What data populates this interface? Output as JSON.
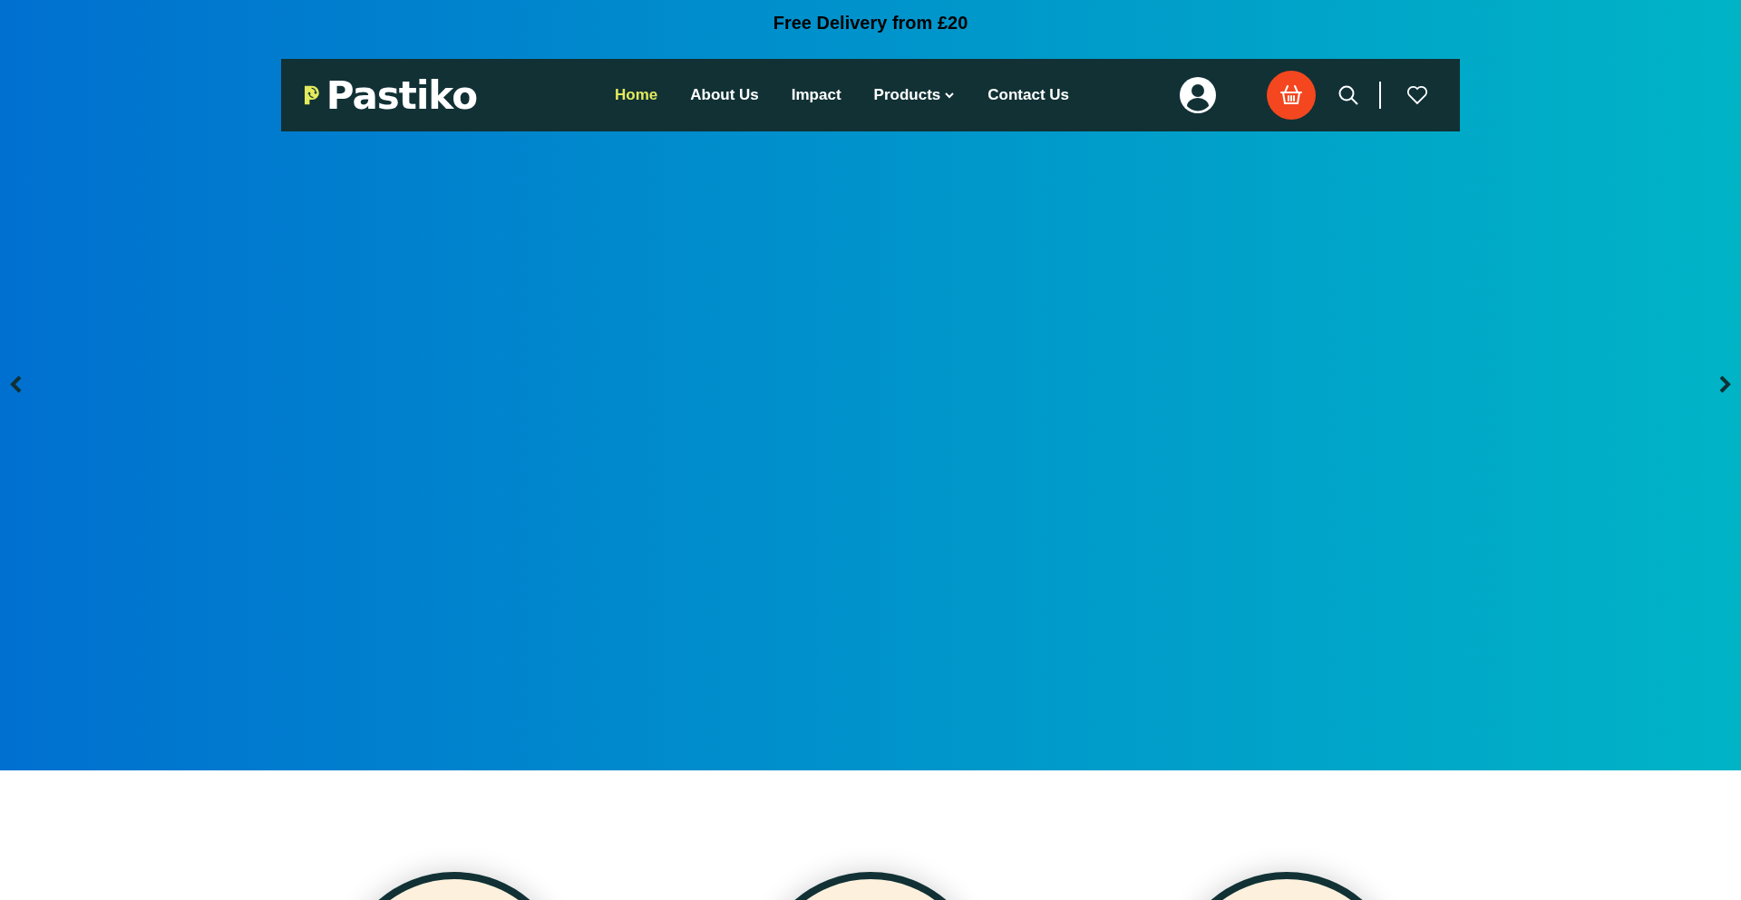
{
  "announcement": "Free Delivery from £20",
  "header": {
    "logo_text": "Pastiko",
    "nav": [
      {
        "label": "Home",
        "selected": true,
        "dropdown": false
      },
      {
        "label": "About Us",
        "selected": false,
        "dropdown": false
      },
      {
        "label": "Impact",
        "selected": false,
        "dropdown": false
      },
      {
        "label": "Products",
        "selected": false,
        "dropdown": true
      },
      {
        "label": "Contact Us",
        "selected": false,
        "dropdown": false
      }
    ]
  },
  "features": [
    {
      "kind": "circle"
    },
    {
      "kind": "circle"
    },
    {
      "kind": "circle"
    }
  ]
}
